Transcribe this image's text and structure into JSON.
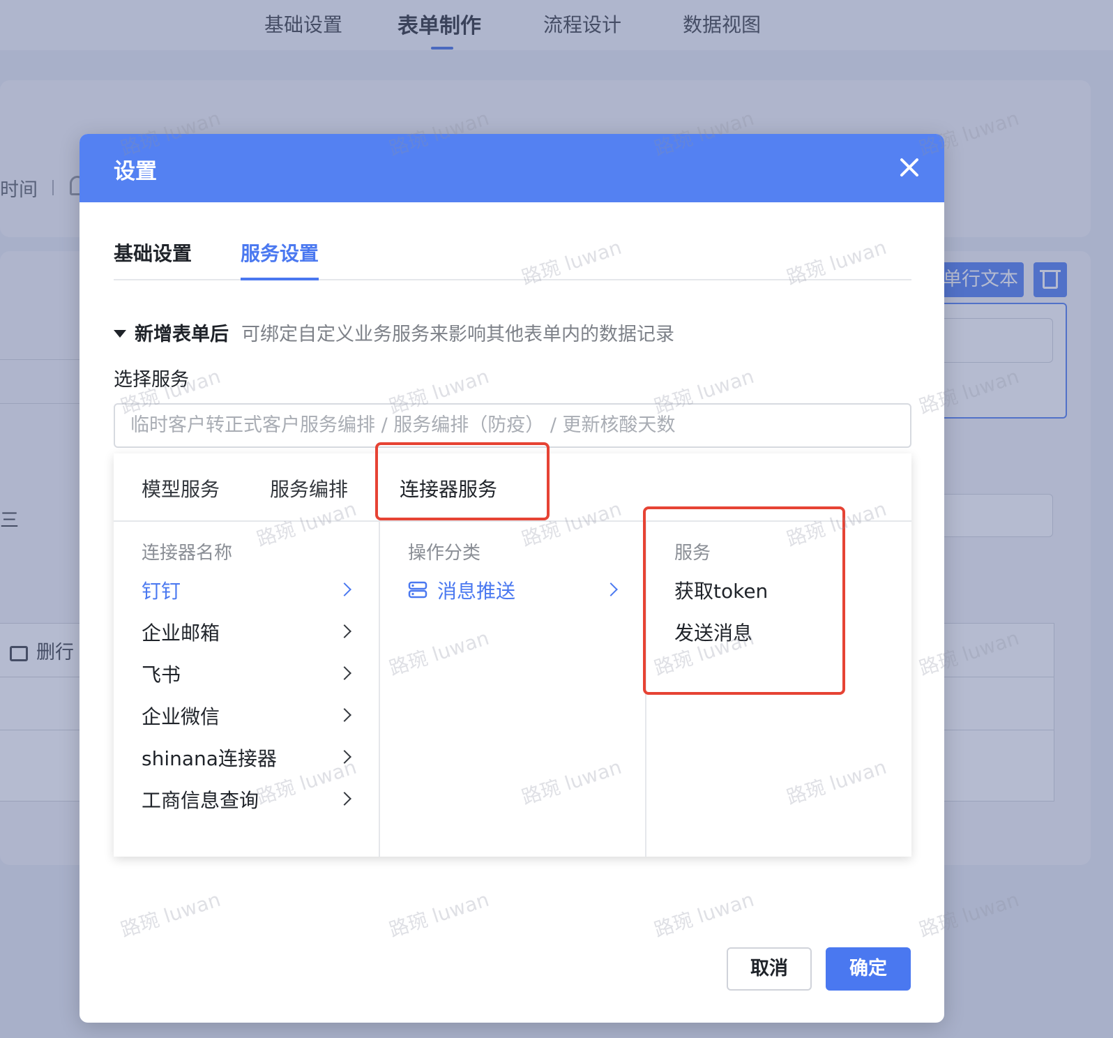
{
  "background": {
    "top_tabs": [
      {
        "label": "基础设置"
      },
      {
        "label": "表单制作"
      },
      {
        "label": "流程设计"
      },
      {
        "label": "数据视图"
      }
    ],
    "meta_text": "时间",
    "field_label": "单行文本",
    "delete_row": "删行",
    "name_fragment": "三"
  },
  "modal": {
    "title": "设置",
    "tabs": [
      {
        "label": "基础设置"
      },
      {
        "label": "服务设置"
      }
    ],
    "section": {
      "title": "新增表单后",
      "description": "可绑定自定义业务服务来影响其他表单内的数据记录"
    },
    "select_label": "选择服务",
    "select_placeholder": "临时客户转正式客户服务编排 / 服务编排（防疫） / 更新核酸天数",
    "dropdown": {
      "tabs": [
        {
          "label": "模型服务"
        },
        {
          "label": "服务编排"
        },
        {
          "label": "连接器服务"
        }
      ],
      "col1_head": "连接器名称",
      "connectors": [
        {
          "label": "钉钉"
        },
        {
          "label": "企业邮箱"
        },
        {
          "label": "飞书"
        },
        {
          "label": "企业微信"
        },
        {
          "label": "shinana连接器"
        },
        {
          "label": "工商信息查询"
        }
      ],
      "col2_head": "操作分类",
      "categories": [
        {
          "label": "消息推送"
        }
      ],
      "col3_head": "服务",
      "services": [
        {
          "label": "获取token"
        },
        {
          "label": "发送消息"
        }
      ]
    },
    "cancel_label": "取消",
    "ok_label": "确定"
  },
  "watermark": "路琬 luwan",
  "colors": {
    "primary": "#4a78f0",
    "header": "#5481f2",
    "highlight": "#e64334"
  }
}
